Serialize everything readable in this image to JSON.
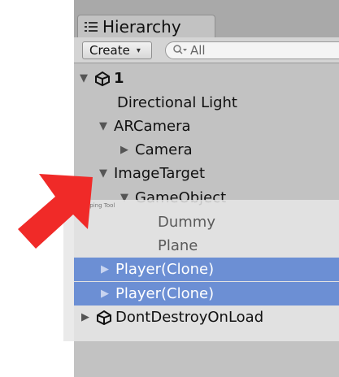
{
  "tab": {
    "label": "Hierarchy"
  },
  "toolbar": {
    "create_label": "Create",
    "create_caret": "▾",
    "search_placeholder": "All"
  },
  "tree": {
    "scene_label": "1",
    "directional_light": "Directional Light",
    "arcamera": "ARCamera",
    "camera": "Camera",
    "image_target": "ImageTarget",
    "game_object": "GameObject",
    "dummy": "Dummy",
    "plane": "Plane",
    "player_1": "Player(Clone)",
    "player_2": "Player(Clone)",
    "dont_destroy": "DontDestroyOnLoad"
  },
  "snipping_tool": {
    "title": "Snipping Tool"
  },
  "arrows": {
    "expanded": "▼",
    "collapsed": "▶"
  },
  "colors": {
    "panel_bg": "#c2c2c2",
    "selection": "#6c8fd4",
    "red_arrow": "#f02a28"
  }
}
